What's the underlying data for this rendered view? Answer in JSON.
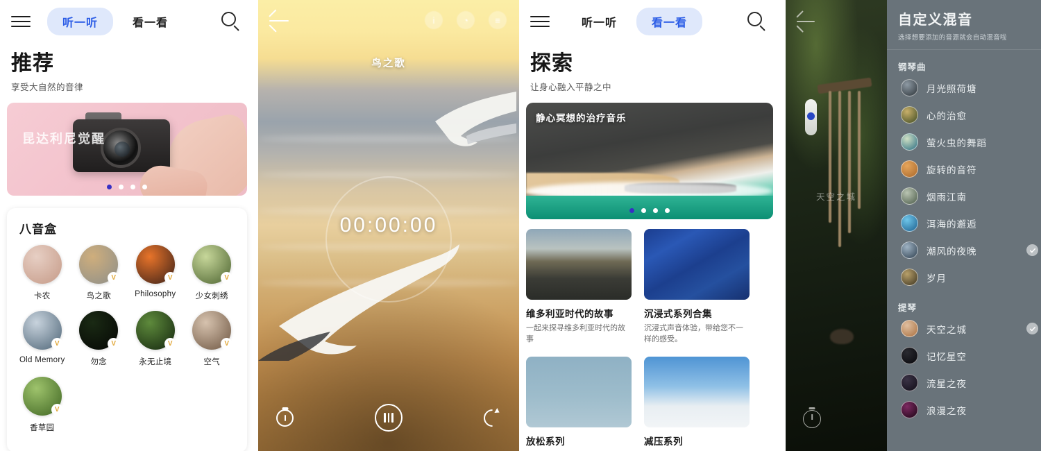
{
  "panel1": {
    "nav": {
      "menu_icon": "hamburger-icon",
      "search_icon": "search-icon",
      "tabs": [
        {
          "label": "听一听",
          "active": true
        },
        {
          "label": "看一看",
          "active": false
        }
      ]
    },
    "title": "推荐",
    "subtitle": "享受大自然的音律",
    "hero": {
      "title": "昆达利尼觉醒",
      "dots": 4,
      "active_dot": 0
    },
    "section": {
      "title": "八音盒",
      "items": [
        {
          "label": "卡农",
          "badge": "",
          "c1": "#e7cfc4",
          "c2": "#c59a87"
        },
        {
          "label": "鸟之歌",
          "badge": "V",
          "c1": "#cfae7c",
          "c2": "#8d8f8a"
        },
        {
          "label": "Philosophy",
          "badge": "V",
          "c1": "#e8742a",
          "c2": "#3a2018"
        },
        {
          "label": "少女刺绣",
          "badge": "V",
          "c1": "#c7d79a",
          "c2": "#4c6330"
        },
        {
          "label": "Old Memory",
          "badge": "V",
          "c1": "#c8d3dd",
          "c2": "#4e6577"
        },
        {
          "label": "勿念",
          "badge": "V",
          "c1": "#1a2a14",
          "c2": "#050604"
        },
        {
          "label": "永无止境",
          "badge": "V",
          "c1": "#5e8a3c",
          "c2": "#14260e"
        },
        {
          "label": "空气",
          "badge": "V",
          "c1": "#d6c2ae",
          "c2": "#6e5642"
        },
        {
          "label": "香草园",
          "badge": "V",
          "c1": "#9ec36c",
          "c2": "#3f6522"
        }
      ]
    }
  },
  "panel2": {
    "back_icon": "back-arrow-icon",
    "top_icons": [
      "info-icon",
      "timer-icon",
      "list-icon"
    ],
    "song_title": "鸟之歌",
    "elapsed": "00:00:00",
    "controls": {
      "timer_icon": "stopwatch-icon",
      "play_pause_icon": "pause-icon",
      "loop_icon": "repeat-icon"
    }
  },
  "panel3": {
    "nav": {
      "menu_icon": "hamburger-icon",
      "search_icon": "search-icon",
      "tabs": [
        {
          "label": "听一听",
          "active": false
        },
        {
          "label": "看一看",
          "active": true
        }
      ]
    },
    "title": "探索",
    "subtitle": "让身心融入平静之中",
    "banner": {
      "title": "静心冥想的治疗音乐",
      "dots": 4,
      "active_dot": 0
    },
    "cards": [
      {
        "title": "维多利亚时代的故事",
        "desc": "一起来探寻维多利亚时代的故事",
        "art": "victorian"
      },
      {
        "title": "沉浸式系列合集",
        "desc": "沉浸式声音体验，带给您不一样的感受。",
        "art": "starry"
      },
      {
        "title": "放松系列",
        "desc": "",
        "art": "flamingo"
      },
      {
        "title": "减压系列",
        "desc": "",
        "art": "clouds"
      }
    ]
  },
  "panel4": {
    "back_icon": "back-arrow-icon",
    "mix_name": "天空之城",
    "stopwatch_icon": "stopwatch-icon",
    "header": {
      "title": "自定义混音",
      "subtitle": "选择想要添加的音源就会自动混音啦"
    },
    "sections": [
      {
        "name": "钢琴曲",
        "items": [
          {
            "label": "月光照荷塘",
            "selected": false,
            "c1": "#8e9aa4",
            "c2": "#2c3338"
          },
          {
            "label": "心的治愈",
            "selected": false,
            "c1": "#c9b06a",
            "c2": "#3d4a22"
          },
          {
            "label": "萤火虫的舞蹈",
            "selected": false,
            "c1": "#cfe0c4",
            "c2": "#2a6d82"
          },
          {
            "label": "旋转的音符",
            "selected": false,
            "c1": "#e5a55c",
            "c2": "#a9682a"
          },
          {
            "label": "烟雨江南",
            "selected": false,
            "c1": "#b9c4b2",
            "c2": "#4a5a48"
          },
          {
            "label": "洱海的邂逅",
            "selected": false,
            "c1": "#6ec6ea",
            "c2": "#1d5f8e"
          },
          {
            "label": "潮风的夜晚",
            "selected": true,
            "c1": "#9fb3c4",
            "c2": "#2e3f4e"
          },
          {
            "label": "岁月",
            "selected": false,
            "c1": "#b8a06a",
            "c2": "#3b3320"
          }
        ]
      },
      {
        "name": "提琴",
        "items": [
          {
            "label": "天空之城",
            "selected": true,
            "c1": "#e0bfa0",
            "c2": "#a9703f"
          },
          {
            "label": "记忆星空",
            "selected": false,
            "c1": "#2a2a30",
            "c2": "#08080c"
          },
          {
            "label": "流星之夜",
            "selected": false,
            "c1": "#3b3346",
            "c2": "#110d18"
          },
          {
            "label": "浪漫之夜",
            "selected": false,
            "c1": "#7e2a62",
            "c2": "#1a0514"
          }
        ]
      }
    ]
  }
}
